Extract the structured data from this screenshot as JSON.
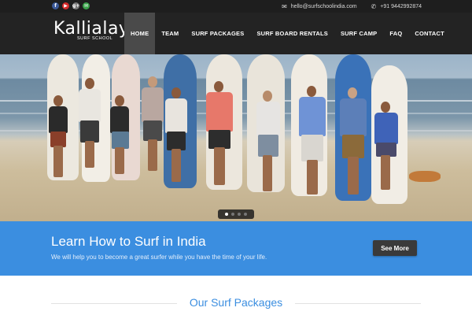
{
  "topbar": {
    "social": [
      {
        "icon": "facebook-icon",
        "glyph": "f",
        "color": "#3b5998"
      },
      {
        "icon": "youtube-icon",
        "glyph": "▶",
        "color": "#d62b2b"
      },
      {
        "icon": "google-plus-icon",
        "glyph": "g+",
        "color": "#7a7a7a"
      },
      {
        "icon": "email-share-icon",
        "glyph": "✉",
        "color": "#3aa24a"
      }
    ],
    "email": "hello@surfschoolindia.com",
    "phone": "+91 9442992874"
  },
  "logo": {
    "word": "Kallialay",
    "sub": "SURF SCHOOL"
  },
  "nav": {
    "items": [
      {
        "label": "HOME",
        "active": true
      },
      {
        "label": "TEAM",
        "active": false
      },
      {
        "label": "SURF PACKAGES",
        "active": false
      },
      {
        "label": "SURF BOARD RENTALS",
        "active": false
      },
      {
        "label": "SURF CAMP",
        "active": false
      },
      {
        "label": "FAQ",
        "active": false
      },
      {
        "label": "CONTACT",
        "active": false
      }
    ]
  },
  "slider": {
    "slides": 4,
    "current": 1
  },
  "banner": {
    "heading": "Learn How to Surf in India",
    "subtext": "We will help you to become a great surfer while you have the time of your life.",
    "button": "See More",
    "color": "#3b8ee0"
  },
  "packages": {
    "heading": "Our Surf Packages"
  }
}
